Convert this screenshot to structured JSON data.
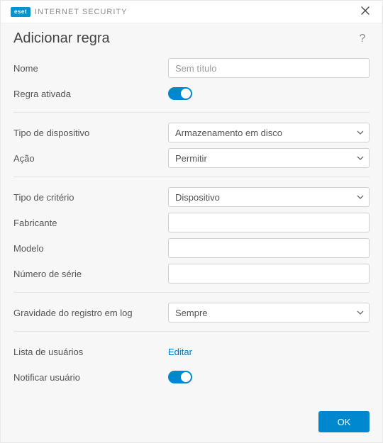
{
  "titlebar": {
    "brand_badge": "eset",
    "brand_title": "INTERNET SECURITY"
  },
  "header": {
    "page_title": "Adicionar regra",
    "help_symbol": "?"
  },
  "form": {
    "nome": {
      "label": "Nome",
      "placeholder": "Sem título",
      "value": ""
    },
    "regra_ativada": {
      "label": "Regra ativada",
      "on": true
    },
    "tipo_dispositivo": {
      "label": "Tipo de dispositivo",
      "value": "Armazenamento em disco"
    },
    "acao": {
      "label": "Ação",
      "value": "Permitir"
    },
    "tipo_criterio": {
      "label": "Tipo de critério",
      "value": "Dispositivo"
    },
    "fabricante": {
      "label": "Fabricante",
      "value": ""
    },
    "modelo": {
      "label": "Modelo",
      "value": ""
    },
    "numero_serie": {
      "label": "Número de série",
      "value": ""
    },
    "gravidade_log": {
      "label": "Gravidade do registro em log",
      "value": "Sempre"
    },
    "lista_usuarios": {
      "label": "Lista de usuários",
      "link_text": "Editar"
    },
    "notificar_usuario": {
      "label": "Notificar usuário",
      "on": true
    }
  },
  "footer": {
    "ok_label": "OK"
  }
}
